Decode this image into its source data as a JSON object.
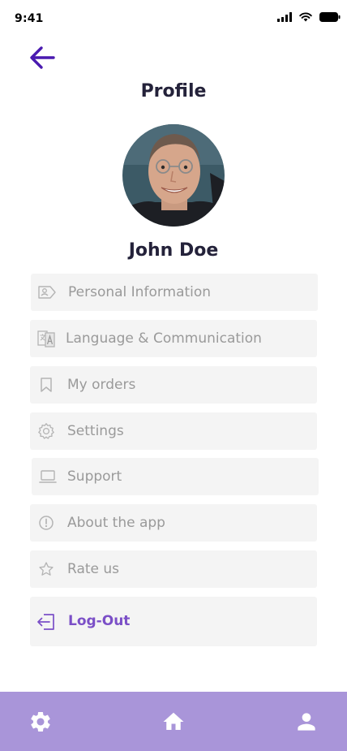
{
  "status_bar": {
    "time": "9:41"
  },
  "header": {
    "title": "Profile"
  },
  "user": {
    "name": "John Doe"
  },
  "menu": [
    {
      "label": "Personal Information",
      "icon": "id-card-icon"
    },
    {
      "label": "Language & Communication",
      "icon": "translate-icon"
    },
    {
      "label": "My orders",
      "icon": "bookmark-icon"
    },
    {
      "label": "Settings",
      "icon": "gear-icon"
    },
    {
      "label": "Support",
      "icon": "laptop-icon"
    },
    {
      "label": "About the app",
      "icon": "info-icon"
    },
    {
      "label": "Rate us",
      "icon": "star-icon"
    }
  ],
  "logout": {
    "label": "Log-Out",
    "icon": "logout-icon"
  },
  "bottom_nav": {
    "items": [
      "settings-gear-icon",
      "home-icon",
      "user-icon"
    ]
  },
  "colors": {
    "accent": "#7b4fc7",
    "nav_background": "#a995d9",
    "back_arrow": "#4a1ab0",
    "item_background": "#f4f4f4",
    "item_text": "#9a9a9a"
  }
}
